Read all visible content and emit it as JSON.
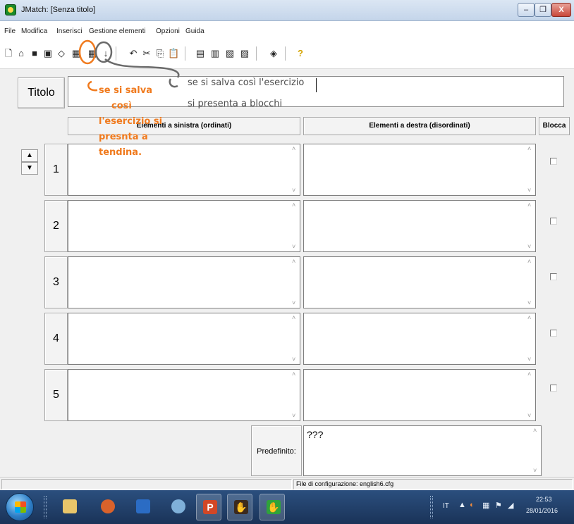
{
  "window": {
    "title": "JMatch: [Senza titolo]",
    "min_label": "–",
    "max_label": "❐",
    "close_label": "X"
  },
  "menu": {
    "file": "File",
    "edit": "Modifica",
    "insert": "Inserisci",
    "manage": "Gestione elementi",
    "options": "Opzioni",
    "help": "Guida"
  },
  "toolbar": {
    "help_label": "?"
  },
  "title_section": {
    "label": "Titolo",
    "value": ""
  },
  "columns": {
    "left": "Elementi a sinistra (ordinati)",
    "right": "Elementi a destra (disordinati)",
    "lock": "Blocca"
  },
  "rows": [
    {
      "number": "1",
      "left": "",
      "right": ""
    },
    {
      "number": "2",
      "left": "",
      "right": ""
    },
    {
      "number": "3",
      "left": "",
      "right": ""
    },
    {
      "number": "4",
      "left": "",
      "right": ""
    },
    {
      "number": "5",
      "left": "",
      "right": ""
    }
  ],
  "default": {
    "label": "Predefinito:",
    "value": "???"
  },
  "status": {
    "config": "File di configurazione: english6.cfg"
  },
  "annotations": {
    "orange_lines": [
      "se si salva",
      "così",
      "l'esercizio si",
      "presnta a",
      "tendina."
    ],
    "gray_line1": "se si salva così l'esercizio",
    "gray_line2": "si presenta a blocchi"
  },
  "taskbar": {
    "lang": "IT",
    "time": "22:53",
    "date": "28/01/2016"
  },
  "colors": {
    "annotation_orange": "#f07a1d",
    "annotation_gray": "#4b4b4b",
    "taskbar": "#1a3358"
  }
}
